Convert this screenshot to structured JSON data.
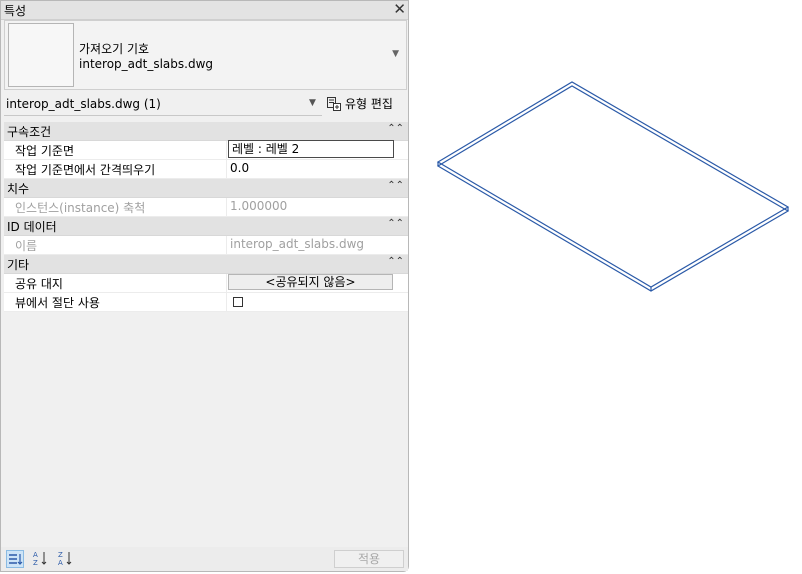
{
  "panel": {
    "title": "특성",
    "close_icon": "close-icon"
  },
  "type_selector": {
    "family": "가져오기 기호",
    "type": "interop_adt_slabs.dwg"
  },
  "filter": {
    "value": "interop_adt_slabs.dwg (1)",
    "edit_type_label": "유형 편집"
  },
  "properties": {
    "constraints": {
      "label": "구속조건",
      "work_plane": {
        "name": "작업 기준면",
        "value": "레벨 : 레벨 2"
      },
      "offset": {
        "name": "작업 기준면에서 간격띄우기",
        "value": "0.0"
      }
    },
    "dimensions": {
      "label": "치수",
      "scale": {
        "name": "인스턴스(instance) 축척",
        "value": "1.000000"
      }
    },
    "id_data": {
      "label": "ID 데이터",
      "name_row": {
        "name": "이름",
        "value": "interop_adt_slabs.dwg"
      }
    },
    "other": {
      "label": "기타",
      "shared_site": {
        "name": "공유 대지",
        "value": "<공유되지 않음>"
      },
      "cut_in_view": {
        "name": "뷰에서 절단 사용",
        "checked": false
      }
    }
  },
  "footer": {
    "apply_label": "적용"
  },
  "colors": {
    "accent": "#2b5aa8",
    "selected_bg": "#cde4f7"
  }
}
